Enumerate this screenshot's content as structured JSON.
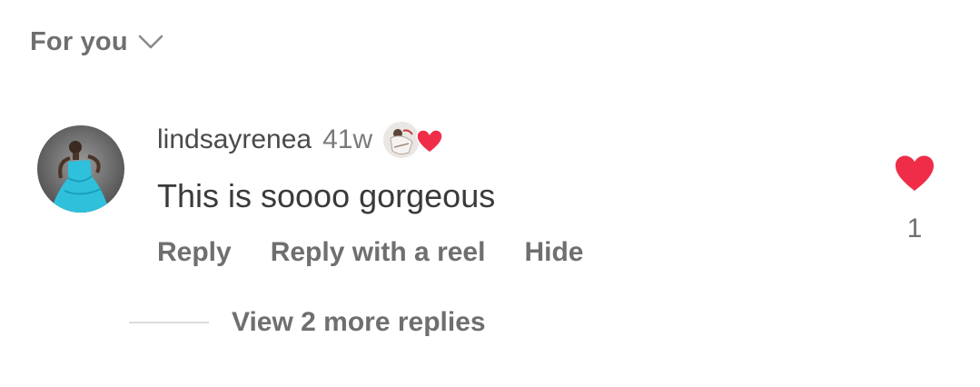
{
  "header": {
    "sort_label": "For you",
    "sort_icon": "chevron-down-icon"
  },
  "comment": {
    "username": "lindsayrenea",
    "time_ago": "41w",
    "text": "This is soooo gorgeous",
    "liked_by_author_icon": "heart-icon",
    "actions": {
      "reply": "Reply",
      "reply_with_reel": "Reply with a reel",
      "hide": "Hide"
    },
    "like_count": "1",
    "view_replies": "View 2 more replies"
  },
  "colors": {
    "heart": "#ef2d48",
    "muted_text": "#6f6f6f",
    "body_text": "#3a3a3a",
    "divider": "#dcdcdc",
    "avatar_dress": "#2fc0dc"
  }
}
